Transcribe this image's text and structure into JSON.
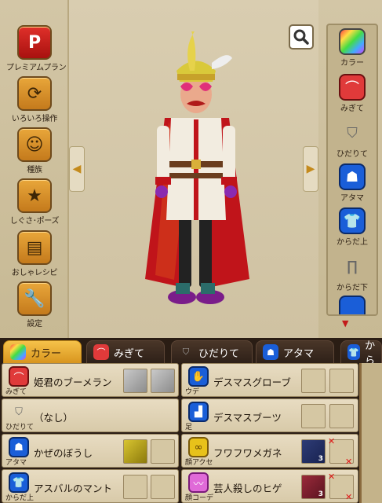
{
  "left_menu": [
    {
      "label": "プレミアムプラン",
      "icon": "premium-p-icon",
      "glyph": "P"
    },
    {
      "label": "いろいろ操作",
      "icon": "refresh-arrows-icon",
      "glyph": "⟳"
    },
    {
      "label": "種族",
      "icon": "race-faces-icon",
      "glyph": "☺"
    },
    {
      "label": "しぐさ･ポーズ",
      "icon": "star-icon",
      "glyph": "★"
    },
    {
      "label": "おしゃレシピ",
      "icon": "recipe-book-icon",
      "glyph": "▤"
    },
    {
      "label": "設定",
      "icon": "wrench-icon",
      "glyph": "🔧"
    }
  ],
  "right_menu": [
    {
      "label": "カラー",
      "icon": "color-palette-icon"
    },
    {
      "label": "みぎて",
      "icon": "boomerang-icon"
    },
    {
      "label": "ひだりて",
      "icon": "shield-icon"
    },
    {
      "label": "アタマ",
      "icon": "hat-icon"
    },
    {
      "label": "からだ上",
      "icon": "shirt-icon"
    },
    {
      "label": "からだ下",
      "icon": "pants-icon"
    }
  ],
  "tabs": [
    {
      "label": "カラー",
      "icon": "color-palette-icon",
      "active": true
    },
    {
      "label": "みぎて",
      "icon": "boomerang-icon",
      "active": false
    },
    {
      "label": "ひだりて",
      "icon": "shield-icon",
      "active": false
    },
    {
      "label": "アタマ",
      "icon": "hat-icon",
      "active": false
    },
    {
      "label": "から",
      "icon": "shirt-icon",
      "active": false
    }
  ],
  "equipment_left": [
    {
      "slot": "みぎて",
      "name": "姫君のブーメラン",
      "icon": "boomerang-icon"
    },
    {
      "slot": "ひだりて",
      "name": "（なし）",
      "icon": "shield-icon"
    },
    {
      "slot": "アタマ",
      "name": "かぜのぼうし",
      "icon": "hat-icon"
    },
    {
      "slot": "からだ上",
      "name": "アスバルのマント",
      "icon": "shirt-icon"
    }
  ],
  "equipment_right": [
    {
      "slot": "ウデ",
      "name": "デスマスグローブ",
      "icon": "glove-icon"
    },
    {
      "slot": "足",
      "name": "デスマスブーツ",
      "icon": "boot-icon"
    },
    {
      "slot": "顔アクセ",
      "name": "フワフワメガネ",
      "icon": "glasses-icon",
      "count": "3"
    },
    {
      "slot": "顔コーデ",
      "name": "芸人殺しのヒゲ",
      "icon": "mustache-icon",
      "count": "3"
    }
  ],
  "colors": {
    "accent_tab": "#f0b43a",
    "panel": "#e2d5b8"
  }
}
